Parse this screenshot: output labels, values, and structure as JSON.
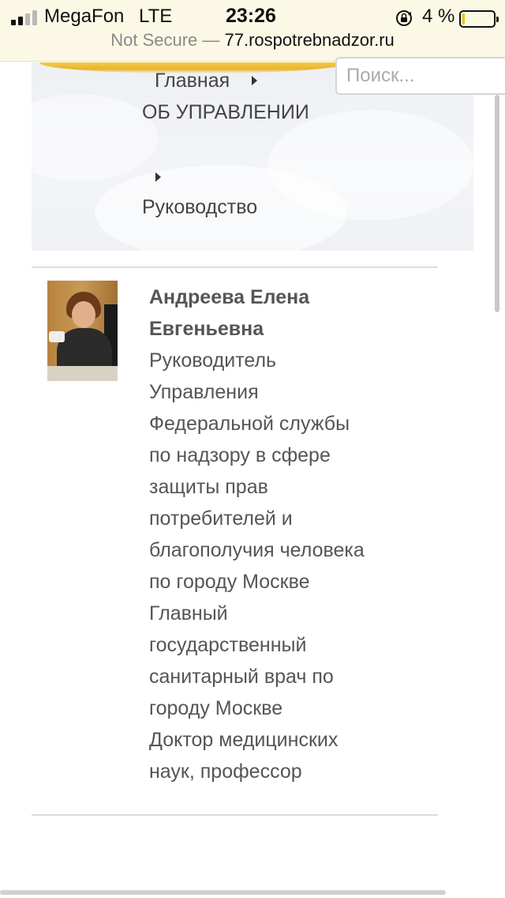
{
  "status_bar": {
    "carrier": "MegaFon",
    "network": "LTE",
    "time": "23:26",
    "battery_percent": "4 %",
    "battery_level": 0.04,
    "icons": [
      "signal-icon",
      "orientation-lock-icon",
      "battery-icon"
    ]
  },
  "url_bar": {
    "security_label": "Not Secure",
    "separator": " — ",
    "domain": "77.rospotrebnadzor.ru"
  },
  "search": {
    "placeholder": "Поиск..."
  },
  "breadcrumb": {
    "home": "Главная",
    "section": "ОБ УПРАВЛЕНИИ",
    "current": "Руководство"
  },
  "person": {
    "name": "Андреева Елена Евгеньевна",
    "description_lines": [
      "Руководитель",
      "Управления",
      "Федеральной службы",
      "по надзору в сфере",
      "защиты прав",
      "потребителей и",
      "благополучия человека",
      "по городу Москве",
      "Главный",
      "государственный",
      "санитарный врач по",
      "городу Москве",
      "Доктор медицинских",
      "наук, профессор"
    ]
  },
  "colors": {
    "url_bar_bg": "#fbf8e6",
    "text": "#555555",
    "accent_gold": "#e8b52c",
    "battery_low": "#e8c400"
  }
}
